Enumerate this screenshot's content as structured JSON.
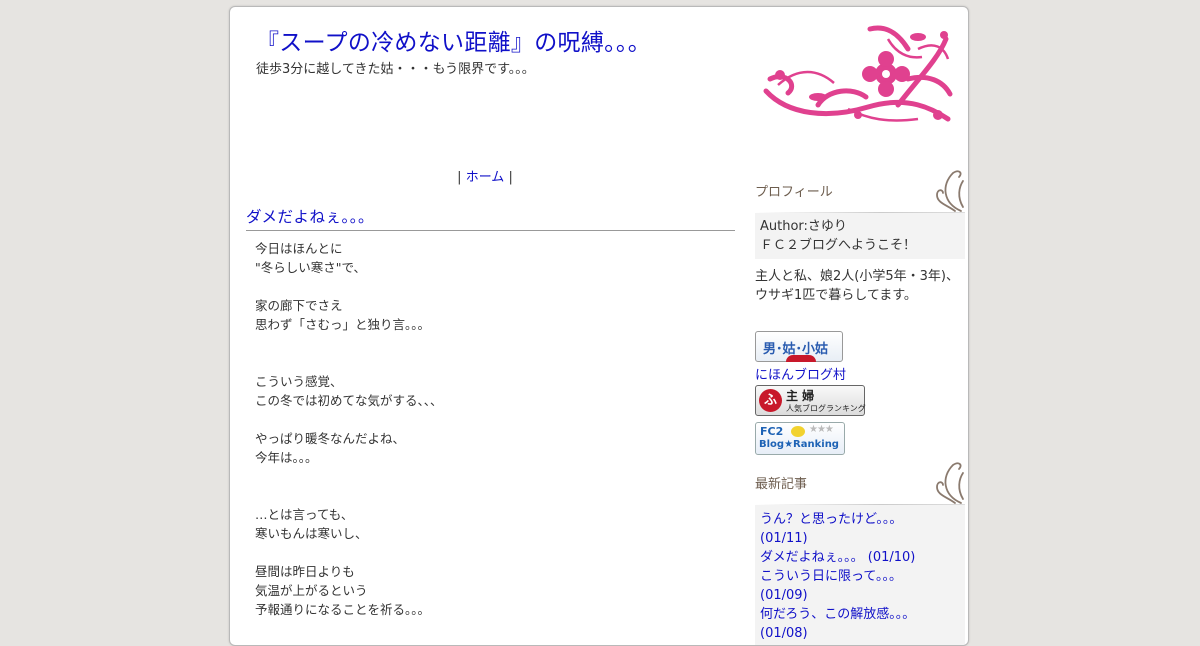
{
  "header": {
    "title": "『スープの冷めない距離』の呪縛。。。",
    "description": "徒歩3分に越してきた姑・・・もう限界です。。。"
  },
  "nav": {
    "prefix": "| ",
    "home": "ホーム",
    "suffix": " |"
  },
  "entry": {
    "title": "ダメだよねぇ。。。",
    "lines": [
      "今日はほんとに",
      "\"冬らしい寒さ\"で、",
      "",
      "家の廊下でさえ",
      "思わず「さむっ」と独り言。。。",
      "",
      "",
      "こういう感覚、",
      "この冬では初めてな気がする、、、",
      "",
      "やっぱり暖冬なんだよね、",
      "今年は。。。",
      "",
      "",
      "…とは言っても、",
      "寒いもんは寒いし、",
      "",
      "昼間は昨日よりも",
      "気温が上がるという",
      "予報通りになることを祈る。。。"
    ]
  },
  "sidebar": {
    "profile": {
      "heading": "プロフィール",
      "author": "Author:さゆり",
      "welcome": "ＦＣ２ブログへようこそ！",
      "bio_line1": "主人と私、娘2人(小学5年・3年)、",
      "bio_line2": "ウサギ1匹で暮らしてます。"
    },
    "badges": {
      "badge1_text": "男･姑･小姑",
      "nihon_link": "にほんブログ村",
      "badge2_mark": "ふ",
      "badge2_title": "主 婦",
      "badge2_sub": "人気ブログランキング",
      "badge3_title": "FC2",
      "badge3_sub": "Blog★Ranking",
      "badge3_stars": "★★★"
    },
    "recent": {
      "heading": "最新記事",
      "items": [
        "うん？と思ったけど。。。",
        "(01/11)",
        "ダメだよねぇ。。。 (01/10)",
        "こういう日に限って。。。",
        "(01/09)",
        "何だろう、この解放感。。。",
        "(01/08)"
      ]
    }
  },
  "colors": {
    "background": "#e6e4e1",
    "title_blue": "#1010c8",
    "ornament_pink": "#e0418f",
    "side_heading": "#6d5d4e"
  },
  "icons": {
    "ornament": "floral-ornament-icon",
    "side_curl": "curl-ornament-icon"
  }
}
